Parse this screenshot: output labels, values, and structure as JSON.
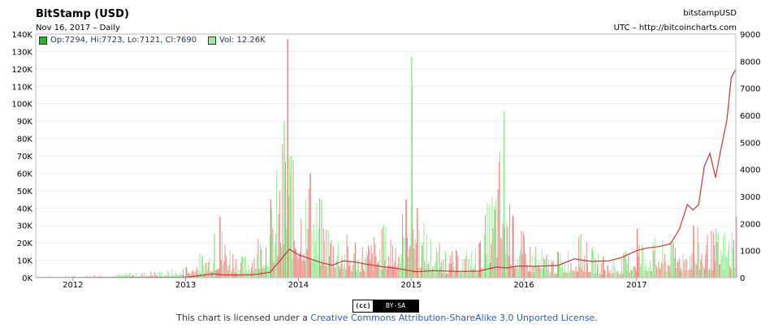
{
  "header": {
    "title": "BitStamp (USD)",
    "subtitle": "Nov 16, 2017 – Daily",
    "symbol": "bitstampUSD",
    "source": "UTC – http://bitcoincharts.com"
  },
  "legend": {
    "ohlc": "Op:7294, Hi:7723, Lo:7121, Cl:7690",
    "vol": "Vol: 12.26K",
    "ohlc_color": "#22bb22",
    "vol_color": "#99ee99"
  },
  "license": {
    "prefix": "This chart is licensed under a ",
    "link_text": "Creative Commons Attribution-ShareAlike 3.0 Unported License",
    "suffix": ".",
    "badge_cc": "(cc)",
    "badge_by": "BY-SA"
  },
  "chart_data": {
    "type": "line",
    "x_labels": [
      "2012",
      "2013",
      "2014",
      "2015",
      "2016",
      "2017"
    ],
    "x_range": [
      2011.67,
      2017.88
    ],
    "left_axis": {
      "title": "",
      "ylim": [
        0,
        140000
      ],
      "ticks": [
        "0K",
        "10K",
        "20K",
        "30K",
        "40K",
        "50K",
        "60K",
        "70K",
        "80K",
        "90K",
        "100K",
        "110K",
        "120K",
        "130K",
        "140K"
      ]
    },
    "right_axis": {
      "title": "",
      "ylim": [
        0,
        9000
      ],
      "ticks": [
        "0",
        "1000",
        "2000",
        "3000",
        "4000",
        "5000",
        "6000",
        "7000",
        "8000",
        "9000"
      ]
    },
    "price_series": {
      "name": "Price",
      "color": "#cc3333",
      "axis": "right",
      "x": [
        2011.67,
        2012.0,
        2012.3,
        2012.6,
        2012.9,
        2013.0,
        2013.25,
        2013.3,
        2013.45,
        2013.6,
        2013.75,
        2013.85,
        2013.92,
        2014.0,
        2014.1,
        2014.2,
        2014.3,
        2014.4,
        2014.5,
        2014.6,
        2014.75,
        2014.85,
        2015.0,
        2015.05,
        2015.2,
        2015.4,
        2015.6,
        2015.75,
        2015.85,
        2015.95,
        2016.1,
        2016.3,
        2016.45,
        2016.5,
        2016.6,
        2016.75,
        2016.85,
        2016.95,
        2017.0,
        2017.1,
        2017.2,
        2017.3,
        2017.38,
        2017.45,
        2017.5,
        2017.55,
        2017.6,
        2017.65,
        2017.7,
        2017.75,
        2017.8,
        2017.84,
        2017.88
      ],
      "values": [
        5,
        6,
        10,
        12,
        13,
        15,
        140,
        110,
        95,
        110,
        200,
        700,
        1050,
        850,
        700,
        560,
        460,
        620,
        580,
        500,
        400,
        360,
        250,
        220,
        260,
        230,
        240,
        390,
        360,
        430,
        420,
        450,
        700,
        660,
        600,
        620,
        720,
        900,
        1000,
        1100,
        1150,
        1250,
        1800,
        2700,
        2500,
        2700,
        4100,
        4600,
        3700,
        4800,
        5800,
        7400,
        7700
      ]
    },
    "volume_series": {
      "name": "Volume",
      "axis": "left",
      "up_color": "#88ee88",
      "down_color": "#f08080",
      "x": [
        2012.0,
        2012.5,
        2013.0,
        2013.25,
        2013.3,
        2013.5,
        2013.75,
        2013.87,
        2013.9,
        2013.93,
        2014.1,
        2014.2,
        2014.5,
        2014.75,
        2014.95,
        2015.0,
        2015.05,
        2015.3,
        2015.6,
        2015.82,
        2015.9,
        2016.1,
        2016.3,
        2016.5,
        2016.7,
        2016.9,
        2017.0,
        2017.3,
        2017.5,
        2017.7,
        2017.88
      ],
      "values": [
        1000,
        3000,
        6000,
        25000,
        35000,
        12000,
        45000,
        90000,
        137000,
        70000,
        60000,
        45000,
        20000,
        30000,
        45000,
        127000,
        40000,
        15000,
        20000,
        95000,
        35000,
        18000,
        15000,
        25000,
        12000,
        15000,
        28000,
        20000,
        30000,
        28000,
        35000
      ]
    }
  }
}
